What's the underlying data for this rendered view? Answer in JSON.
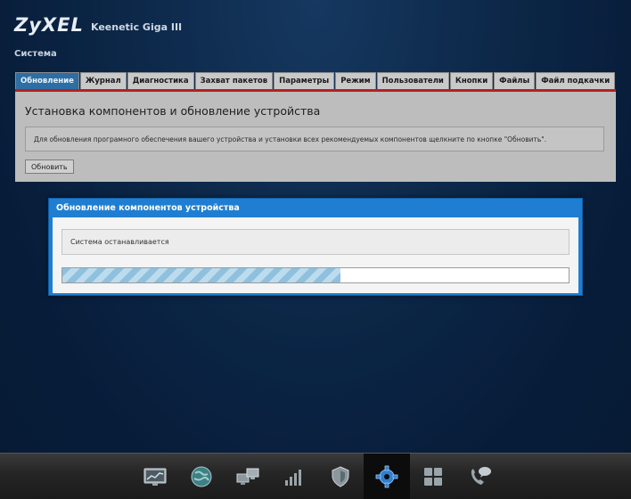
{
  "brand": {
    "logo": "ZyXEL",
    "model": "Keenetic Giga III"
  },
  "section_title": "Система",
  "tabs": [
    {
      "label": "Обновление",
      "active": true
    },
    {
      "label": "Журнал"
    },
    {
      "label": "Диагностика"
    },
    {
      "label": "Захват пакетов"
    },
    {
      "label": "Параметры"
    },
    {
      "label": "Режим"
    },
    {
      "label": "Пользователи"
    },
    {
      "label": "Кнопки"
    },
    {
      "label": "Файлы"
    },
    {
      "label": "Файл подкачки"
    }
  ],
  "panel": {
    "title": "Установка компонентов и обновление устройства",
    "info": "Для обновления програмного обеспечения вашего устройства и установки всех рекомендуемых компонентов щелкните по кнопке \"Обновить\".",
    "button_label": "Обновить"
  },
  "dialog": {
    "title": "Обновление компонентов устройства",
    "status": "Система останавливается",
    "progress": 0.55
  },
  "dock": {
    "items": [
      {
        "icon": "monitor-chart-icon"
      },
      {
        "icon": "globe-icon"
      },
      {
        "icon": "network-computers-icon"
      },
      {
        "icon": "signal-bars-icon"
      },
      {
        "icon": "shield-icon"
      },
      {
        "icon": "gear-icon",
        "active": true
      },
      {
        "icon": "apps-grid-icon"
      },
      {
        "icon": "phone-chat-icon"
      }
    ]
  },
  "colors": {
    "tab_active": "#2d6ea4",
    "panel_border": "#b8201d",
    "dialog_header": "#1f7ed1"
  }
}
